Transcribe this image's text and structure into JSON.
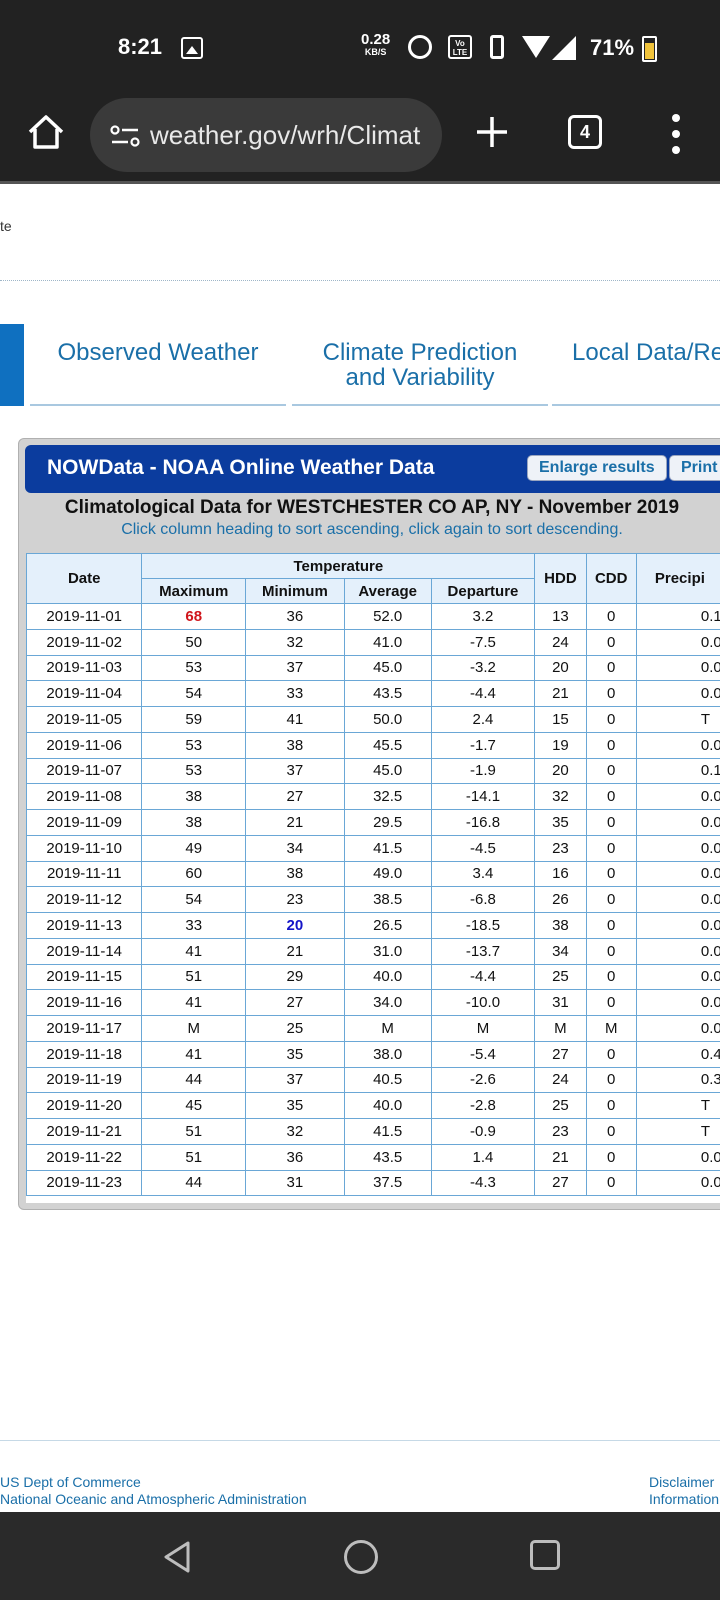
{
  "status_bar": {
    "time": "8:21",
    "net_speed": "0.28",
    "net_unit": "KB/S",
    "volte": "Vo LTE",
    "battery": "71%",
    "icons": [
      "gallery-icon",
      "alarm-icon",
      "volte-icon",
      "vibrate-icon",
      "wifi-icon",
      "signal-icon",
      "battery-icon"
    ]
  },
  "browser": {
    "url": "weather.gov/wrh/Climat",
    "tab_count": "4"
  },
  "page": {
    "fragment": "te",
    "nav": [
      "Observed Weather",
      "Climate Prediction and Variability",
      "Local Data/Re"
    ]
  },
  "widget": {
    "title": "NOWData - NOAA Online Weather Data",
    "enlarge_label": "Enlarge results",
    "print_label": "Print",
    "report_title": "Climatological Data for WESTCHESTER CO AP, NY - November 2019",
    "sort_hint": "Click column heading to sort ascending, click again to sort descending.",
    "headers": {
      "date": "Date",
      "temperature": "Temperature",
      "maximum": "Maximum",
      "minimum": "Minimum",
      "average": "Average",
      "departure": "Departure",
      "hdd": "HDD",
      "cdd": "CDD",
      "precip": "Precipi"
    },
    "rows": [
      [
        "2019-11-01",
        "68",
        "36",
        "52.0",
        "3.2",
        "13",
        "0",
        "0.1"
      ],
      [
        "2019-11-02",
        "50",
        "32",
        "41.0",
        "-7.5",
        "24",
        "0",
        "0.0"
      ],
      [
        "2019-11-03",
        "53",
        "37",
        "45.0",
        "-3.2",
        "20",
        "0",
        "0.0"
      ],
      [
        "2019-11-04",
        "54",
        "33",
        "43.5",
        "-4.4",
        "21",
        "0",
        "0.0"
      ],
      [
        "2019-11-05",
        "59",
        "41",
        "50.0",
        "2.4",
        "15",
        "0",
        "T"
      ],
      [
        "2019-11-06",
        "53",
        "38",
        "45.5",
        "-1.7",
        "19",
        "0",
        "0.0"
      ],
      [
        "2019-11-07",
        "53",
        "37",
        "45.0",
        "-1.9",
        "20",
        "0",
        "0.1"
      ],
      [
        "2019-11-08",
        "38",
        "27",
        "32.5",
        "-14.1",
        "32",
        "0",
        "0.0"
      ],
      [
        "2019-11-09",
        "38",
        "21",
        "29.5",
        "-16.8",
        "35",
        "0",
        "0.0"
      ],
      [
        "2019-11-10",
        "49",
        "34",
        "41.5",
        "-4.5",
        "23",
        "0",
        "0.0"
      ],
      [
        "2019-11-11",
        "60",
        "38",
        "49.0",
        "3.4",
        "16",
        "0",
        "0.0"
      ],
      [
        "2019-11-12",
        "54",
        "23",
        "38.5",
        "-6.8",
        "26",
        "0",
        "0.0"
      ],
      [
        "2019-11-13",
        "33",
        "20",
        "26.5",
        "-18.5",
        "38",
        "0",
        "0.0"
      ],
      [
        "2019-11-14",
        "41",
        "21",
        "31.0",
        "-13.7",
        "34",
        "0",
        "0.0"
      ],
      [
        "2019-11-15",
        "51",
        "29",
        "40.0",
        "-4.4",
        "25",
        "0",
        "0.0"
      ],
      [
        "2019-11-16",
        "41",
        "27",
        "34.0",
        "-10.0",
        "31",
        "0",
        "0.0"
      ],
      [
        "2019-11-17",
        "M",
        "25",
        "M",
        "M",
        "M",
        "M",
        "0.0"
      ],
      [
        "2019-11-18",
        "41",
        "35",
        "38.0",
        "-5.4",
        "27",
        "0",
        "0.4"
      ],
      [
        "2019-11-19",
        "44",
        "37",
        "40.5",
        "-2.6",
        "24",
        "0",
        "0.3"
      ],
      [
        "2019-11-20",
        "45",
        "35",
        "40.0",
        "-2.8",
        "25",
        "0",
        "T"
      ],
      [
        "2019-11-21",
        "51",
        "32",
        "41.5",
        "-0.9",
        "23",
        "0",
        "T"
      ],
      [
        "2019-11-22",
        "51",
        "36",
        "43.5",
        "1.4",
        "21",
        "0",
        "0.0"
      ],
      [
        "2019-11-23",
        "44",
        "31",
        "37.5",
        "-4.3",
        "27",
        "0",
        "0.0"
      ]
    ],
    "colors": {
      "max_highlight": "#d0151b",
      "min_highlight": "#1414c8",
      "header_bar": "#0b3c9e"
    }
  },
  "footer": {
    "left_line1": "US Dept of Commerce",
    "left_line2": "National Oceanic and Atmospheric Administration",
    "right_line1": "Disclaimer",
    "right_line2": "Information"
  }
}
